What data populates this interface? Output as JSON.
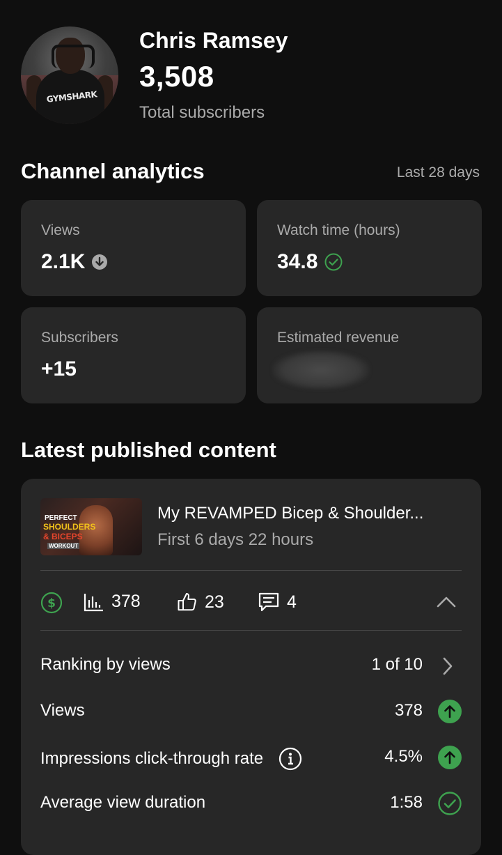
{
  "channel": {
    "name": "Chris Ramsey",
    "subscriber_count": "3,508",
    "subscriber_label": "Total subscribers",
    "avatar_shirt_text": "GYMSHARK"
  },
  "analytics": {
    "title": "Channel analytics",
    "period": "Last 28 days",
    "cards": [
      {
        "label": "Views",
        "value": "2.1K",
        "trend_icon": "arrow-down-circle-icon"
      },
      {
        "label": "Watch time (hours)",
        "value": "34.8",
        "trend_icon": "check-circle-icon"
      },
      {
        "label": "Subscribers",
        "value": "+15"
      },
      {
        "label": "Estimated revenue",
        "value": ""
      }
    ]
  },
  "latest": {
    "title": "Latest published content",
    "video": {
      "title": "My REVAMPED Bicep & Shoulder...",
      "subtitle": "First 6 days 22 hours",
      "thumbnail_text": [
        "PERFECT",
        "SHOULDERS",
        "& BICEPS",
        "WORKOUT"
      ]
    },
    "stats": {
      "views": "378",
      "likes": "23",
      "comments": "4"
    },
    "metrics": [
      {
        "label": "Ranking by views",
        "value": "1 of 10",
        "icon": "chevron-right-icon"
      },
      {
        "label": "Views",
        "value": "378",
        "icon": "arrow-up-circle-icon"
      },
      {
        "label": "Impressions click-through rate",
        "value": "4.5%",
        "icon": "arrow-up-circle-icon",
        "info": true
      },
      {
        "label": "Average view duration",
        "value": "1:58",
        "icon": "check-circle-icon"
      }
    ]
  },
  "colors": {
    "background": "#0f0f0f",
    "card": "#272727",
    "secondary_text": "#aaaaaa",
    "positive": "#3ea24f"
  }
}
